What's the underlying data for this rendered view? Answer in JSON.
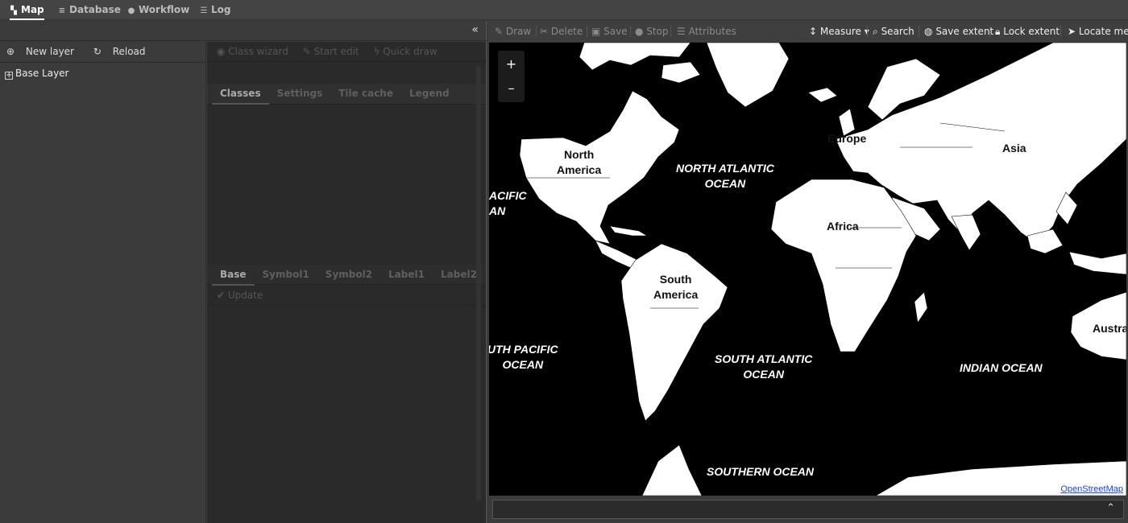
{
  "top_tabs": [
    {
      "label": "Map",
      "icon": "map-icon"
    },
    {
      "label": "Database",
      "icon": "database-icon"
    },
    {
      "label": "Workflow",
      "icon": "users-icon"
    },
    {
      "label": "Log",
      "icon": "list-icon"
    }
  ],
  "left": {
    "collapse_icon": "«",
    "tree_toolbar": {
      "new_layer": "New layer",
      "reload": "Reload"
    },
    "tree_items": [
      {
        "label": "Base Layer",
        "expand": "+"
      }
    ],
    "props_toolbar": [
      "Class wizard",
      "Start edit",
      "Quick draw"
    ],
    "props_tabs": [
      "Classes",
      "Settings",
      "Tile cache",
      "Legend"
    ],
    "style_tabs": [
      "Base",
      "Symbol1",
      "Symbol2",
      "Label1",
      "Label2"
    ],
    "update_label": "Update"
  },
  "map_toolbar": {
    "draw": "Draw",
    "delete": "Delete",
    "save": "Save",
    "stop": "Stop",
    "attributes": "Attributes",
    "measure": "Measure",
    "search": "Search",
    "save_extent": "Save extent",
    "lock_extent": "Lock extent",
    "locate_me": "Locate me"
  },
  "map": {
    "zoom_in": "+",
    "zoom_out": "–",
    "labels": {
      "north_america_1": "North",
      "north_america_2": "America",
      "south_america_1": "South",
      "south_america_2": "America",
      "europe": "Europe",
      "asia": "Asia",
      "africa": "Africa",
      "australia": "Austra",
      "north_atlantic_1": "NORTH ATLANTIC",
      "north_atlantic_2": "OCEAN",
      "pacific_1": "ACIFIC",
      "pacific_2": "AN",
      "south_pacific_1": "UTH PACIFIC",
      "south_pacific_2": "OCEAN",
      "south_atlantic_1": "SOUTH ATLANTIC",
      "south_atlantic_2": "OCEAN",
      "indian": "INDIAN OCEAN",
      "southern": "SOUTHERN OCEAN"
    },
    "attribution": "OpenStreetMap"
  },
  "bottom": {
    "expand_icon": "»"
  }
}
